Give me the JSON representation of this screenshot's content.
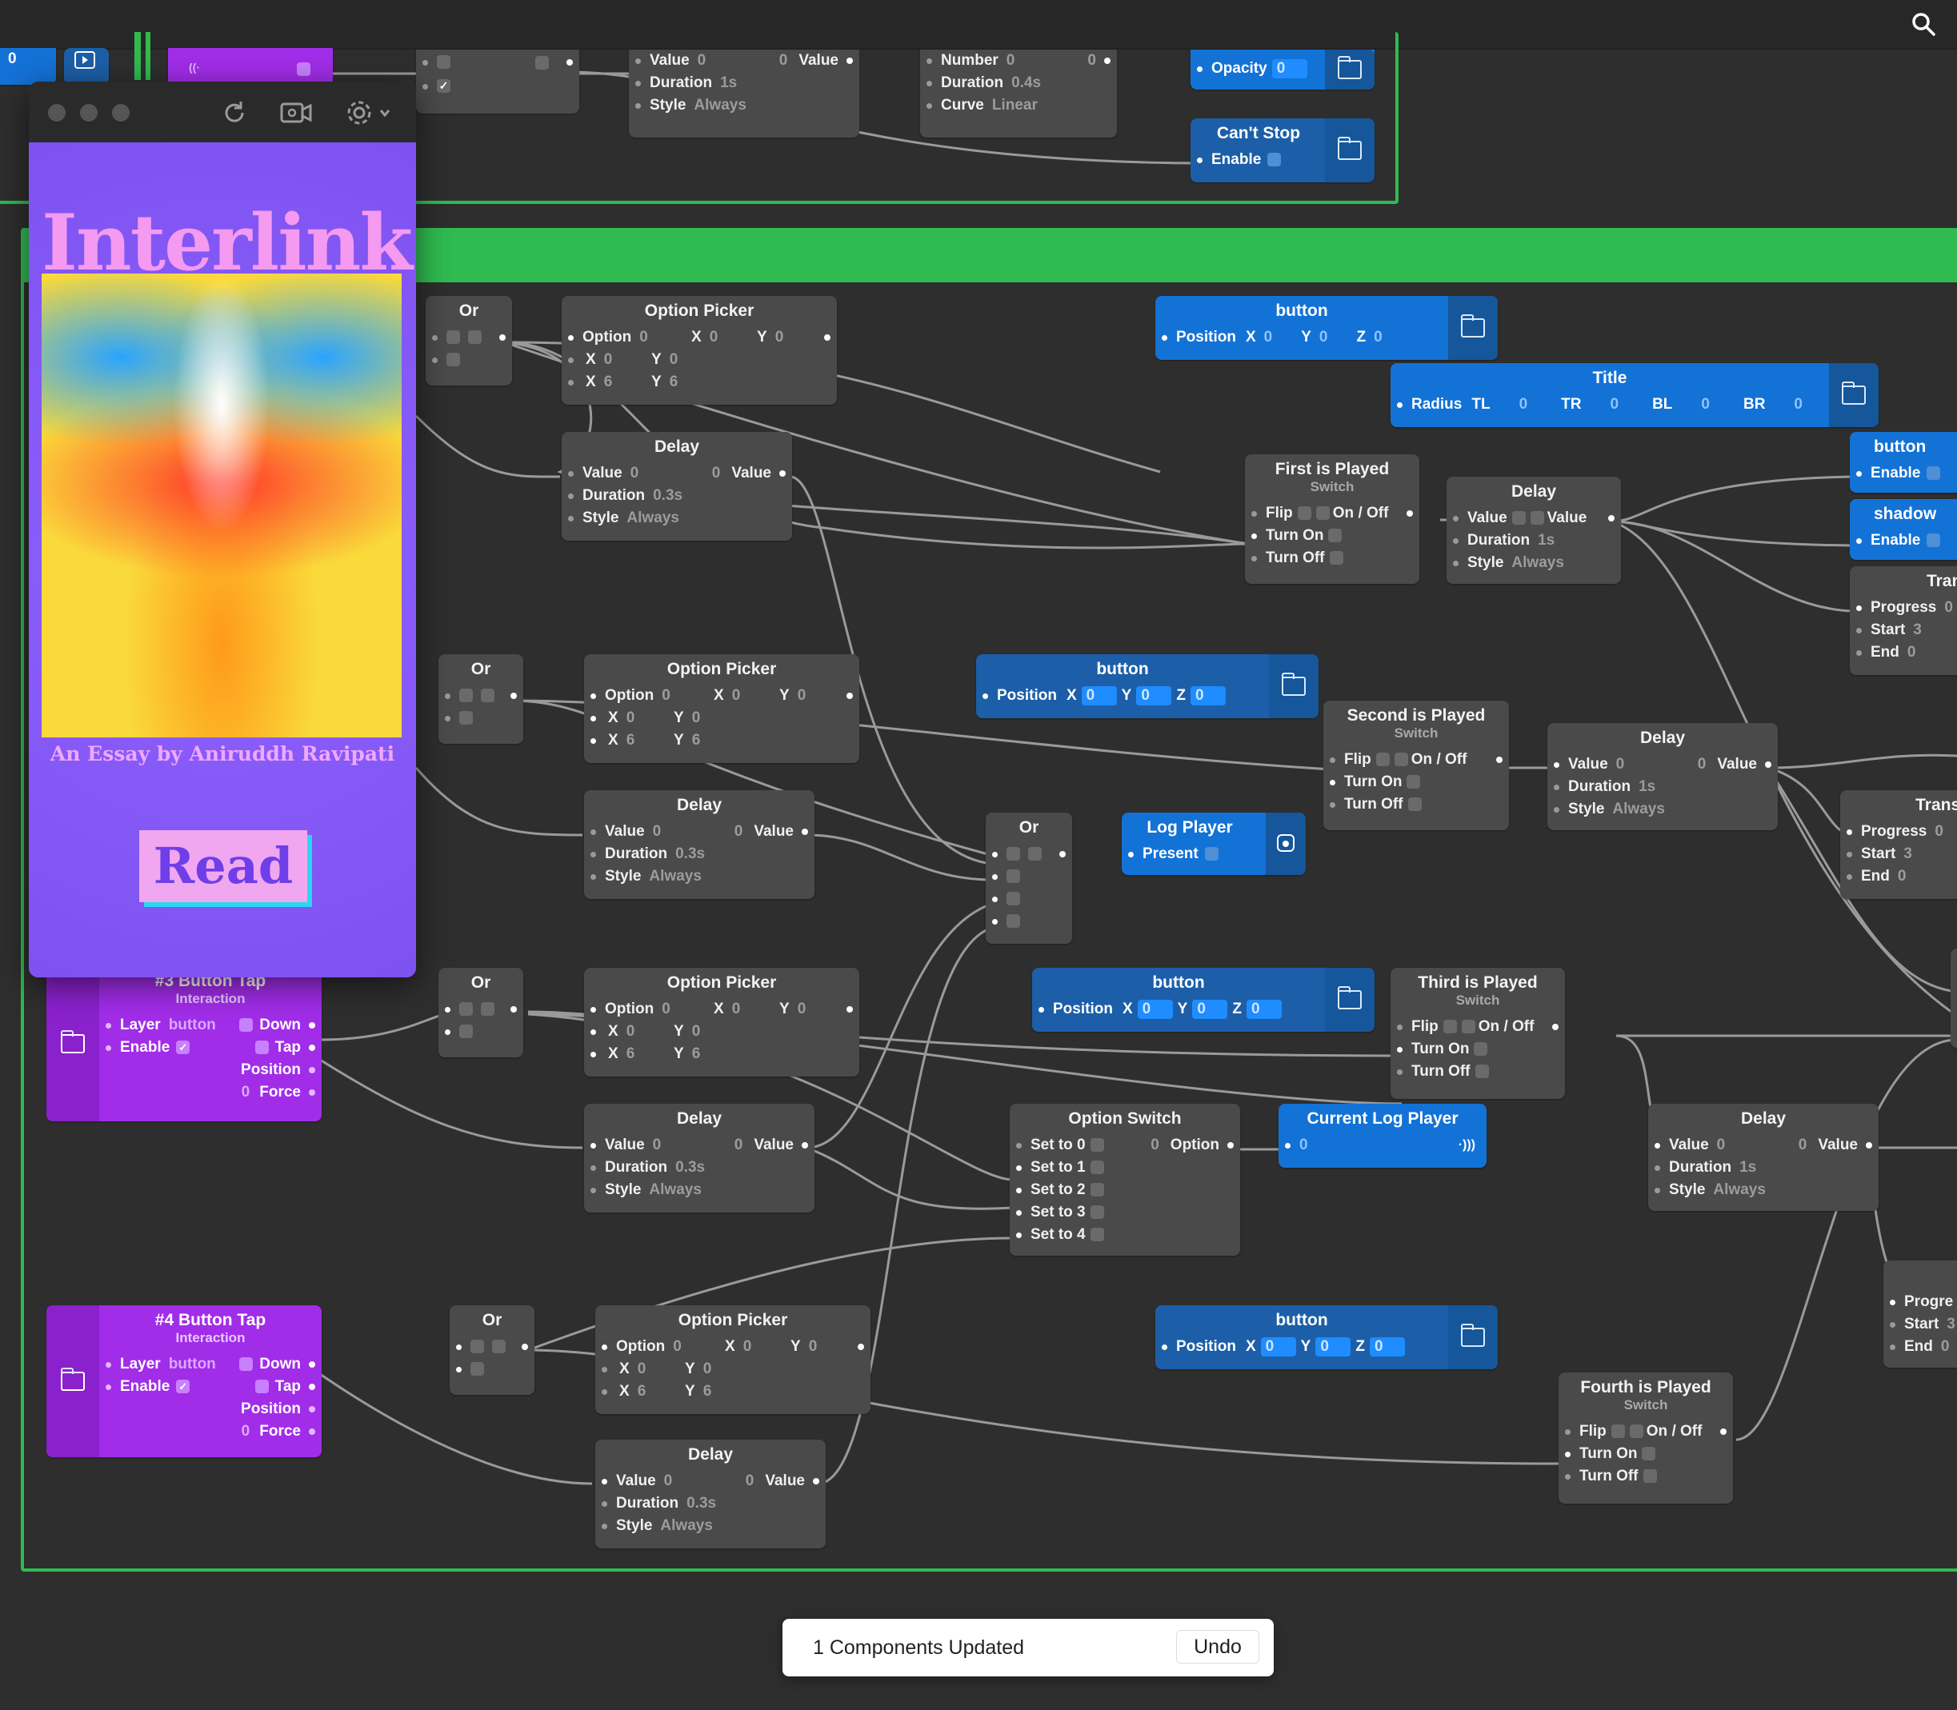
{
  "preview": {
    "poster_title": "Interlink",
    "byline": "An Essay by Aniruddh Ravipati",
    "read_label": "Read"
  },
  "toast": {
    "message": "1 Components Updated",
    "undo_label": "Undo"
  },
  "top": {
    "partial_value": "0",
    "value_node": {
      "value_label": "Value",
      "value": "0",
      "out_val": "0",
      "out_label": "Value",
      "duration_label": "Duration",
      "duration": "1s",
      "style_label": "Style",
      "style": "Always"
    },
    "number_node": {
      "number_label": "Number",
      "number": "0",
      "out_val": "0",
      "duration_label": "Duration",
      "duration": "0.4s",
      "curve_label": "Curve",
      "curve": "Linear"
    },
    "opacity_node": {
      "label": "Opacity",
      "value": "0"
    },
    "cant_stop": {
      "title": "Can't Stop",
      "enable_label": "Enable"
    }
  },
  "labels": {
    "or": "Or",
    "option_picker": "Option Picker",
    "delay": "Delay",
    "option": "Option",
    "x": "X",
    "y": "Y",
    "z": "Z",
    "value": "Value",
    "duration": "Duration",
    "style": "Style",
    "always": "Always",
    "position": "Position",
    "flip": "Flip",
    "on_off": "On / Off",
    "turn_on": "Turn On",
    "turn_off": "Turn Off",
    "switch": "Switch",
    "interaction": "Interaction",
    "layer": "Layer",
    "button": "button",
    "enable": "Enable",
    "down": "Down",
    "tap": "Tap",
    "force": "Force",
    "progress": "Progress",
    "start": "Start",
    "end": "End",
    "zero": "0",
    "six": "6",
    "three": "3",
    "d03": "0.3s",
    "d1s": "1s"
  },
  "nodes": {
    "button_node": "button",
    "title_node": "Title",
    "radius_label": "Radius",
    "tl": "TL",
    "tr": "TR",
    "bl": "BL",
    "br": "BR",
    "first_played": "First is Played",
    "second_played": "Second is Played",
    "third_played": "Third is Played",
    "fourth_played": "Fourth is Played",
    "shadow": "shadow",
    "trans": "Trans",
    "transi": "Transi",
    "t": "T",
    "log_player": "Log Player",
    "present": "Present",
    "option_switch": "Option Switch",
    "set0": "Set to 0",
    "set1": "Set to 1",
    "set2": "Set to 2",
    "set3": "Set to 3",
    "set4": "Set to 4",
    "current_log_player": "Current Log Player",
    "btn3_tap": "#3 Button Tap",
    "btn4_tap": "#4 Button Tap",
    "progre": "Progre",
    "start_partial": "Start"
  },
  "colors": {
    "group_green": "#2fbb4f",
    "canvas": "#2e2e2e",
    "node": "#4a4a4a",
    "blue": "#1372d6",
    "purple": "#a12de8"
  }
}
